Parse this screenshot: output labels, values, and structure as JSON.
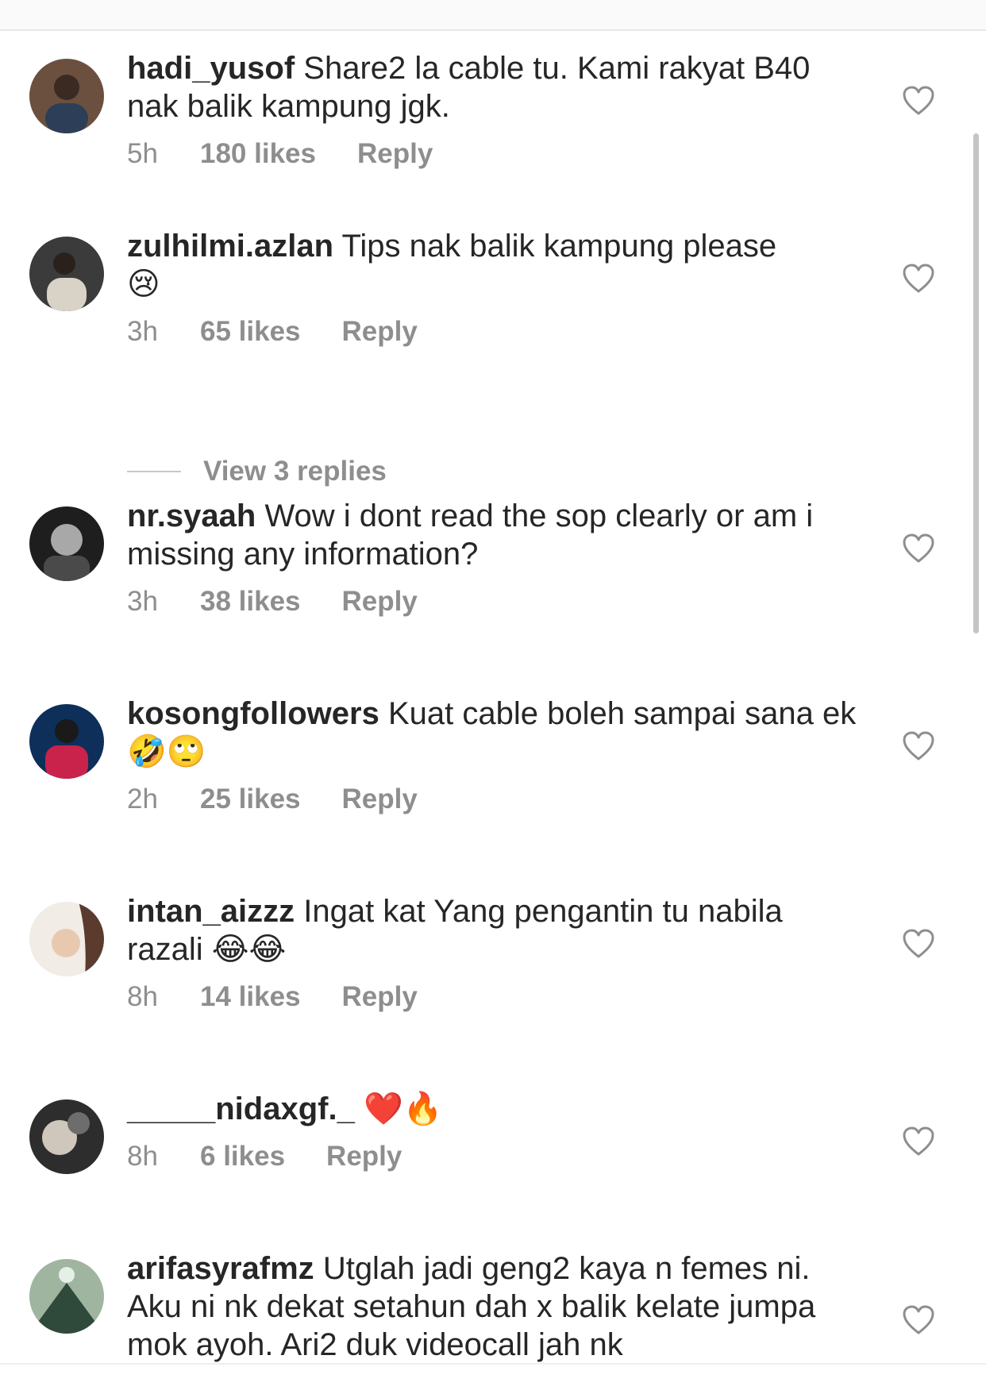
{
  "comments": [
    {
      "username": "hadi_yusof",
      "text": "Share2 la cable tu. Kami rakyat B40 nak balik kampung jgk.",
      "emojis": "",
      "time": "5h",
      "likes": "180 likes",
      "reply": "Reply",
      "avatar_colors": [
        "#7a5a45",
        "#2c3e58"
      ]
    },
    {
      "username": "zulhilmi.azlan",
      "text": "Tips nak balik kampung please",
      "emojis": "😢",
      "time": "3h",
      "likes": "65 likes",
      "reply": "Reply",
      "avatar_colors": [
        "#3b3b3b",
        "#d9d2c6"
      ]
    },
    {
      "username": "nr.syaah",
      "text": "Wow i dont read the sop clearly or am i missing any information?",
      "emojis": "",
      "time": "3h",
      "likes": "38 likes",
      "reply": "Reply",
      "avatar_colors": [
        "#1e1e1e",
        "#a8a8a8"
      ]
    },
    {
      "username": "kosongfollowers",
      "text": "Kuat cable boleh sampai sana ek",
      "emojis": "🤣🙄",
      "time": "2h",
      "likes": "25 likes",
      "reply": "Reply",
      "avatar_colors": [
        "#0d2f5a",
        "#c9224b"
      ]
    },
    {
      "username": "intan_aizzz",
      "text": "Ingat kat Yang pengantin tu nabila razali",
      "emojis": "😂😂",
      "time": "8h",
      "likes": "14 likes",
      "reply": "Reply",
      "avatar_colors": [
        "#f1ece6",
        "#5a3b2e"
      ]
    },
    {
      "username": "_____nidaxgf._",
      "text": "",
      "emojis": "❤️🔥",
      "time": "8h",
      "likes": "6 likes",
      "reply": "Reply",
      "avatar_colors": [
        "#2d2d2d",
        "#cfc7bb"
      ]
    },
    {
      "username": "arifasyrafmz",
      "text": "Utglah jadi geng2 kaya n femes ni. Aku ni nk dekat setahun dah x balik kelate jumpa mok ayoh. Ari2 duk videocall jah nk",
      "emojis": "",
      "time": "",
      "likes": "",
      "reply": "",
      "avatar_colors": [
        "#9fb5a0",
        "#2f4a3a"
      ]
    }
  ],
  "view_replies": "View 3 replies"
}
